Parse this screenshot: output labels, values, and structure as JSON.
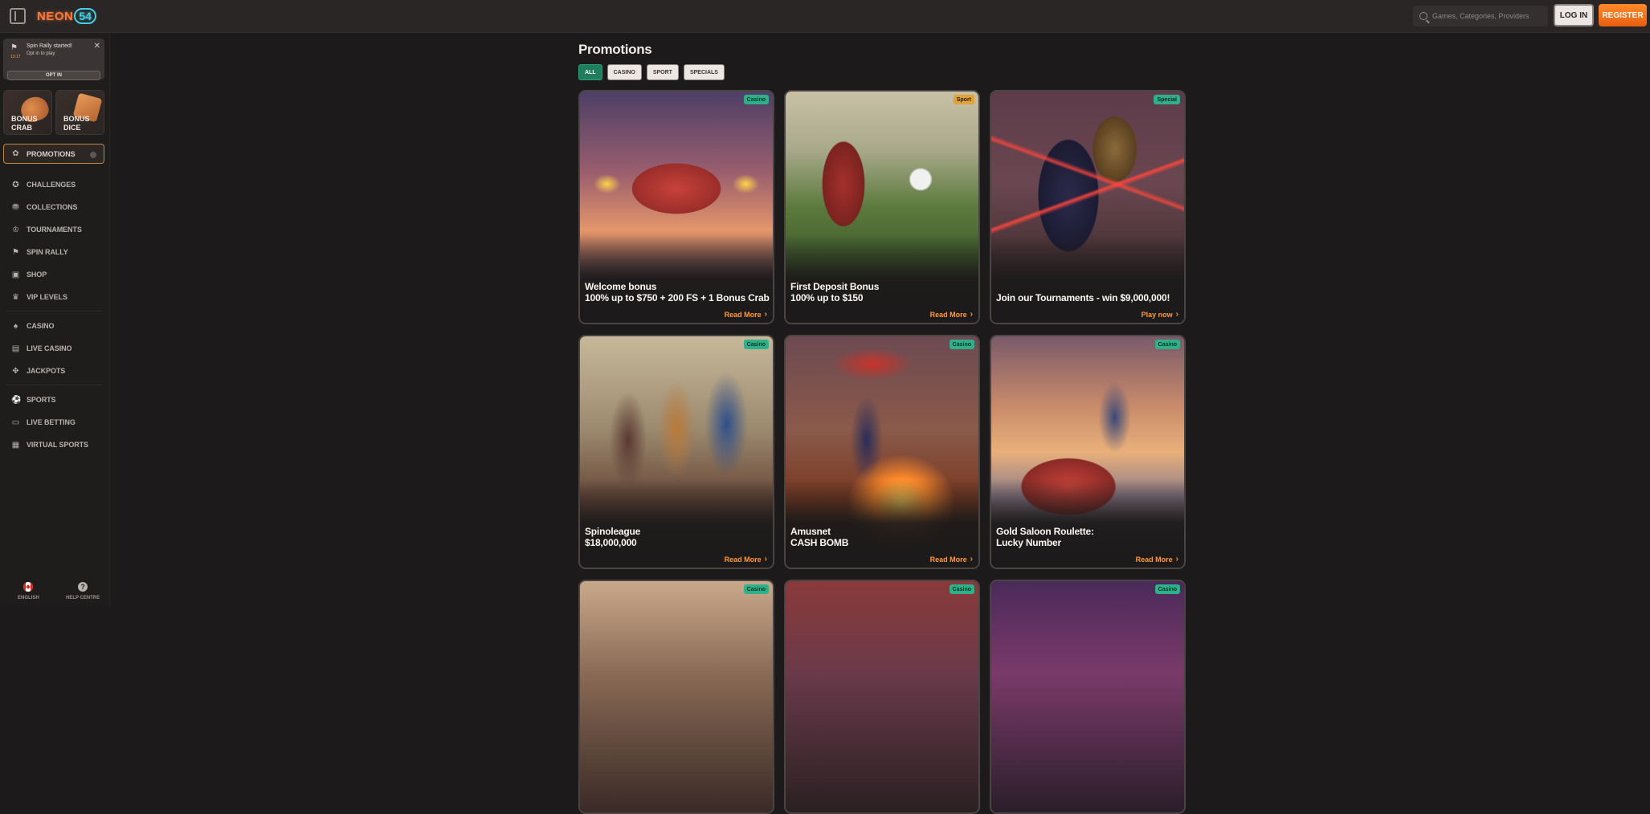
{
  "header": {
    "logo_neon": "NEON",
    "logo_num": "54",
    "search_placeholder": "Games, Categories, Providers",
    "login_label": "LOG IN",
    "register_label": "REGISTER"
  },
  "notification": {
    "title": "Spin Rally started!",
    "subtitle": "Opt in to play",
    "time": "13:17",
    "button": "OPT IN"
  },
  "bonus_tiles": [
    {
      "label": "BONUS CRAB"
    },
    {
      "label": "BONUS DICE"
    }
  ],
  "sidebar": {
    "promotions_label": "PROMOTIONS",
    "items": [
      {
        "label": "CHALLENGES",
        "icon": "trophy-badge-icon"
      },
      {
        "label": "COLLECTIONS",
        "icon": "treasure-icon"
      },
      {
        "label": "TOURNAMENTS",
        "icon": "cup-icon"
      },
      {
        "label": "SPIN RALLY",
        "icon": "flag-icon"
      },
      {
        "label": "SHOP",
        "icon": "shop-icon"
      },
      {
        "label": "VIP LEVELS",
        "icon": "crown-icon"
      },
      {
        "label": "CASINO",
        "icon": "casino-icon"
      },
      {
        "label": "LIVE CASINO",
        "icon": "live-casino-icon"
      },
      {
        "label": "JACKPOTS",
        "icon": "jackpot-icon"
      },
      {
        "label": "SPORTS",
        "icon": "ball-icon"
      },
      {
        "label": "LIVE BETTING",
        "icon": "live-betting-icon"
      },
      {
        "label": "VIRTUAL SPORTS",
        "icon": "virtual-sports-icon"
      }
    ],
    "language_label": "ENGLISH",
    "help_label": "HELP CENTRE"
  },
  "page": {
    "title": "Promotions",
    "filters": [
      "ALL",
      "CASINO",
      "SPORT",
      "SPECIALS"
    ],
    "active_filter": "ALL"
  },
  "cards": [
    {
      "badge": "Casino",
      "title_line1": "Welcome bonus",
      "title_line2": "100% up to $750 + 200 FS + 1 Bonus Crab",
      "cta": "Read More"
    },
    {
      "badge": "Sport",
      "title_line1": "First Deposit Bonus",
      "title_line2": "100% up to $150",
      "cta": "Read More"
    },
    {
      "badge": "Special",
      "title_line1": "Join our Tournaments - win $9,000,000!",
      "title_line2": "",
      "cta": "Play now"
    },
    {
      "badge": "Casino",
      "title_line1": "Spinoleague",
      "title_line2": "$18,000,000",
      "cta": "Read More"
    },
    {
      "badge": "Casino",
      "title_line1": "Amusnet",
      "title_line2": "CASH BOMB",
      "cta": "Read More"
    },
    {
      "badge": "Casino",
      "title_line1": "Gold Saloon Roulette:",
      "title_line2": "Lucky Number",
      "cta": "Read More"
    },
    {
      "badge": "Casino",
      "title_line1": "",
      "title_line2": "",
      "cta": ""
    },
    {
      "badge": "Casino",
      "title_line1": "",
      "title_line2": "",
      "cta": ""
    },
    {
      "badge": "Casino",
      "title_line1": "",
      "title_line2": "",
      "cta": ""
    }
  ],
  "colors": {
    "accent_orange": "#ff9a3c",
    "badge_casino": "#2fb08a",
    "badge_sport": "#e2a23a",
    "badge_special": "#2fb08a",
    "filter_active": "#1f7e5e"
  }
}
